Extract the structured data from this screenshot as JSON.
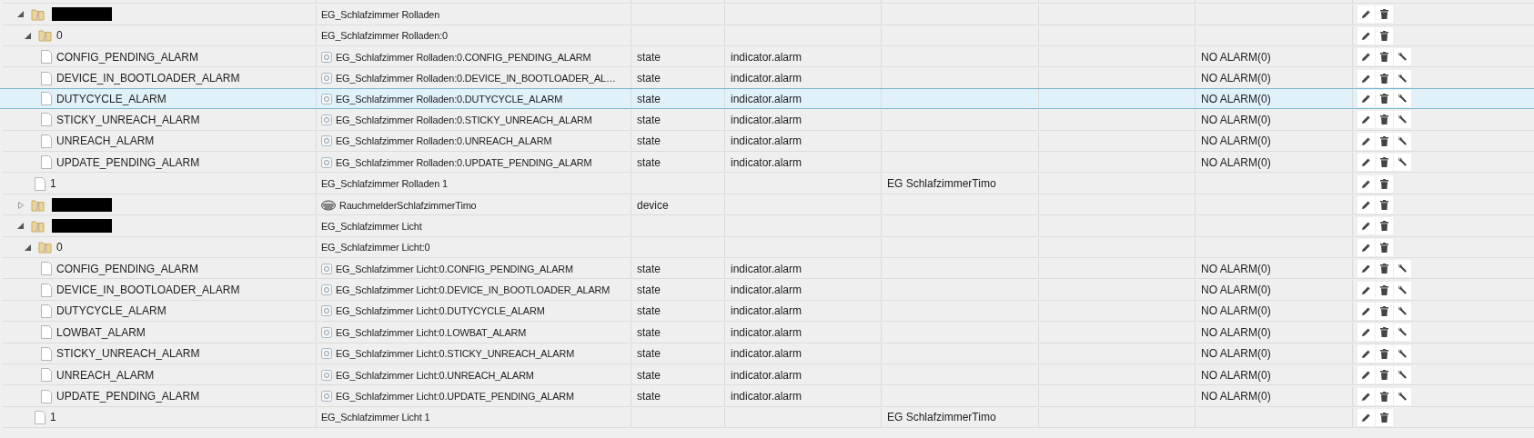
{
  "rows": [
    {
      "kind": "folder",
      "expanded": true,
      "redacted": true,
      "selected": false,
      "column_2": "EG_Schlafzimmer Rolladen",
      "children": [
        {
          "kind": "folder",
          "expanded": true,
          "selected": false,
          "column_1": "0",
          "column_2": "EG_Schlafzimmer Rolladen:0",
          "children": [
            {
              "kind": "state",
              "selected": false,
              "column_1": "CONFIG_PENDING_ALARM",
              "column_2": "EG_Schlafzimmer Rolladen:0.CONFIG_PENDING_ALARM",
              "column_3": "state",
              "column_4": "indicator.alarm",
              "column_7": "NO ALARM(0)"
            },
            {
              "kind": "state",
              "selected": false,
              "column_1": "DEVICE_IN_BOOTLOADER_ALARM",
              "column_2": "EG_Schlafzimmer Rolladen:0.DEVICE_IN_BOOTLOADER_AL…",
              "column_3": "state",
              "column_4": "indicator.alarm",
              "column_7": "NO ALARM(0)"
            },
            {
              "kind": "state",
              "selected": true,
              "column_1": "DUTYCYCLE_ALARM",
              "column_2": "EG_Schlafzimmer Rolladen:0.DUTYCYCLE_ALARM",
              "column_3": "state",
              "column_4": "indicator.alarm",
              "column_7": "NO ALARM(0)"
            },
            {
              "kind": "state",
              "selected": false,
              "column_1": "STICKY_UNREACH_ALARM",
              "column_2": "EG_Schlafzimmer Rolladen:0.STICKY_UNREACH_ALARM",
              "column_3": "state",
              "column_4": "indicator.alarm",
              "column_7": "NO ALARM(0)"
            },
            {
              "kind": "state",
              "selected": false,
              "column_1": "UNREACH_ALARM",
              "column_2": "EG_Schlafzimmer Rolladen:0.UNREACH_ALARM",
              "column_3": "state",
              "column_4": "indicator.alarm",
              "column_7": "NO ALARM(0)"
            },
            {
              "kind": "state",
              "selected": false,
              "column_1": "UPDATE_PENDING_ALARM",
              "column_2": "EG_Schlafzimmer Rolladen:0.UPDATE_PENDING_ALARM",
              "column_3": "state",
              "column_4": "indicator.alarm",
              "column_7": "NO ALARM(0)"
            }
          ]
        },
        {
          "kind": "object",
          "selected": false,
          "column_1": "1",
          "column_2": "EG_Schlafzimmer Rolladen 1",
          "column_5": "EG SchlafzimmerTimo"
        }
      ]
    },
    {
      "kind": "device",
      "expanded": false,
      "redacted": true,
      "selected": false,
      "column_2": "RauchmelderSchlafzimmerTimo",
      "column_3": "device"
    },
    {
      "kind": "folder",
      "expanded": true,
      "redacted": true,
      "selected": false,
      "column_2": "EG_Schlafzimmer Licht",
      "children": [
        {
          "kind": "folder",
          "expanded": true,
          "selected": false,
          "column_1": "0",
          "column_2": "EG_Schlafzimmer Licht:0",
          "children": [
            {
              "kind": "state",
              "selected": false,
              "column_1": "CONFIG_PENDING_ALARM",
              "column_2": "EG_Schlafzimmer Licht:0.CONFIG_PENDING_ALARM",
              "column_3": "state",
              "column_4": "indicator.alarm",
              "column_7": "NO ALARM(0)"
            },
            {
              "kind": "state",
              "selected": false,
              "column_1": "DEVICE_IN_BOOTLOADER_ALARM",
              "column_2": "EG_Schlafzimmer Licht:0.DEVICE_IN_BOOTLOADER_ALARM",
              "column_3": "state",
              "column_4": "indicator.alarm",
              "column_7": "NO ALARM(0)"
            },
            {
              "kind": "state",
              "selected": false,
              "column_1": "DUTYCYCLE_ALARM",
              "column_2": "EG_Schlafzimmer Licht:0.DUTYCYCLE_ALARM",
              "column_3": "state",
              "column_4": "indicator.alarm",
              "column_7": "NO ALARM(0)"
            },
            {
              "kind": "state",
              "selected": false,
              "column_1": "LOWBAT_ALARM",
              "column_2": "EG_Schlafzimmer Licht:0.LOWBAT_ALARM",
              "column_3": "state",
              "column_4": "indicator.alarm",
              "column_7": "NO ALARM(0)"
            },
            {
              "kind": "state",
              "selected": false,
              "column_1": "STICKY_UNREACH_ALARM",
              "column_2": "EG_Schlafzimmer Licht:0.STICKY_UNREACH_ALARM",
              "column_3": "state",
              "column_4": "indicator.alarm",
              "column_7": "NO ALARM(0)"
            },
            {
              "kind": "state",
              "selected": false,
              "column_1": "UNREACH_ALARM",
              "column_2": "EG_Schlafzimmer Licht:0.UNREACH_ALARM",
              "column_3": "state",
              "column_4": "indicator.alarm",
              "column_7": "NO ALARM(0)"
            },
            {
              "kind": "state",
              "selected": false,
              "column_1": "UPDATE_PENDING_ALARM",
              "column_2": "EG_Schlafzimmer Licht:0.UPDATE_PENDING_ALARM",
              "column_3": "state",
              "column_4": "indicator.alarm",
              "column_7": "NO ALARM(0)"
            }
          ]
        },
        {
          "kind": "object",
          "selected": false,
          "column_1": "1",
          "column_2": "EG_Schlafzimmer Licht 1",
          "column_5": "EG SchlafzimmerTimo"
        }
      ]
    }
  ]
}
